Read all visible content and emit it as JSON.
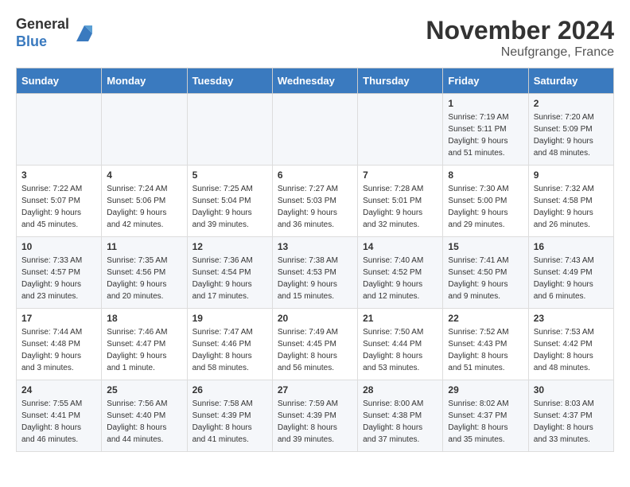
{
  "header": {
    "logo_line1": "General",
    "logo_line2": "Blue",
    "month": "November 2024",
    "location": "Neufgrange, France"
  },
  "days_of_week": [
    "Sunday",
    "Monday",
    "Tuesday",
    "Wednesday",
    "Thursday",
    "Friday",
    "Saturday"
  ],
  "weeks": [
    [
      {
        "day": "",
        "empty": true
      },
      {
        "day": "",
        "empty": true
      },
      {
        "day": "",
        "empty": true
      },
      {
        "day": "",
        "empty": true
      },
      {
        "day": "",
        "empty": true
      },
      {
        "day": "1",
        "sunrise": "7:19 AM",
        "sunset": "5:11 PM",
        "daylight": "9 hours and 51 minutes."
      },
      {
        "day": "2",
        "sunrise": "7:20 AM",
        "sunset": "5:09 PM",
        "daylight": "9 hours and 48 minutes."
      }
    ],
    [
      {
        "day": "3",
        "sunrise": "7:22 AM",
        "sunset": "5:07 PM",
        "daylight": "9 hours and 45 minutes."
      },
      {
        "day": "4",
        "sunrise": "7:24 AM",
        "sunset": "5:06 PM",
        "daylight": "9 hours and 42 minutes."
      },
      {
        "day": "5",
        "sunrise": "7:25 AM",
        "sunset": "5:04 PM",
        "daylight": "9 hours and 39 minutes."
      },
      {
        "day": "6",
        "sunrise": "7:27 AM",
        "sunset": "5:03 PM",
        "daylight": "9 hours and 36 minutes."
      },
      {
        "day": "7",
        "sunrise": "7:28 AM",
        "sunset": "5:01 PM",
        "daylight": "9 hours and 32 minutes."
      },
      {
        "day": "8",
        "sunrise": "7:30 AM",
        "sunset": "5:00 PM",
        "daylight": "9 hours and 29 minutes."
      },
      {
        "day": "9",
        "sunrise": "7:32 AM",
        "sunset": "4:58 PM",
        "daylight": "9 hours and 26 minutes."
      }
    ],
    [
      {
        "day": "10",
        "sunrise": "7:33 AM",
        "sunset": "4:57 PM",
        "daylight": "9 hours and 23 minutes."
      },
      {
        "day": "11",
        "sunrise": "7:35 AM",
        "sunset": "4:56 PM",
        "daylight": "9 hours and 20 minutes."
      },
      {
        "day": "12",
        "sunrise": "7:36 AM",
        "sunset": "4:54 PM",
        "daylight": "9 hours and 17 minutes."
      },
      {
        "day": "13",
        "sunrise": "7:38 AM",
        "sunset": "4:53 PM",
        "daylight": "9 hours and 15 minutes."
      },
      {
        "day": "14",
        "sunrise": "7:40 AM",
        "sunset": "4:52 PM",
        "daylight": "9 hours and 12 minutes."
      },
      {
        "day": "15",
        "sunrise": "7:41 AM",
        "sunset": "4:50 PM",
        "daylight": "9 hours and 9 minutes."
      },
      {
        "day": "16",
        "sunrise": "7:43 AM",
        "sunset": "4:49 PM",
        "daylight": "9 hours and 6 minutes."
      }
    ],
    [
      {
        "day": "17",
        "sunrise": "7:44 AM",
        "sunset": "4:48 PM",
        "daylight": "9 hours and 3 minutes."
      },
      {
        "day": "18",
        "sunrise": "7:46 AM",
        "sunset": "4:47 PM",
        "daylight": "9 hours and 1 minute."
      },
      {
        "day": "19",
        "sunrise": "7:47 AM",
        "sunset": "4:46 PM",
        "daylight": "8 hours and 58 minutes."
      },
      {
        "day": "20",
        "sunrise": "7:49 AM",
        "sunset": "4:45 PM",
        "daylight": "8 hours and 56 minutes."
      },
      {
        "day": "21",
        "sunrise": "7:50 AM",
        "sunset": "4:44 PM",
        "daylight": "8 hours and 53 minutes."
      },
      {
        "day": "22",
        "sunrise": "7:52 AM",
        "sunset": "4:43 PM",
        "daylight": "8 hours and 51 minutes."
      },
      {
        "day": "23",
        "sunrise": "7:53 AM",
        "sunset": "4:42 PM",
        "daylight": "8 hours and 48 minutes."
      }
    ],
    [
      {
        "day": "24",
        "sunrise": "7:55 AM",
        "sunset": "4:41 PM",
        "daylight": "8 hours and 46 minutes."
      },
      {
        "day": "25",
        "sunrise": "7:56 AM",
        "sunset": "4:40 PM",
        "daylight": "8 hours and 44 minutes."
      },
      {
        "day": "26",
        "sunrise": "7:58 AM",
        "sunset": "4:39 PM",
        "daylight": "8 hours and 41 minutes."
      },
      {
        "day": "27",
        "sunrise": "7:59 AM",
        "sunset": "4:39 PM",
        "daylight": "8 hours and 39 minutes."
      },
      {
        "day": "28",
        "sunrise": "8:00 AM",
        "sunset": "4:38 PM",
        "daylight": "8 hours and 37 minutes."
      },
      {
        "day": "29",
        "sunrise": "8:02 AM",
        "sunset": "4:37 PM",
        "daylight": "8 hours and 35 minutes."
      },
      {
        "day": "30",
        "sunrise": "8:03 AM",
        "sunset": "4:37 PM",
        "daylight": "8 hours and 33 minutes."
      }
    ]
  ],
  "labels": {
    "sunrise": "Sunrise:",
    "sunset": "Sunset:",
    "daylight": "Daylight:"
  }
}
